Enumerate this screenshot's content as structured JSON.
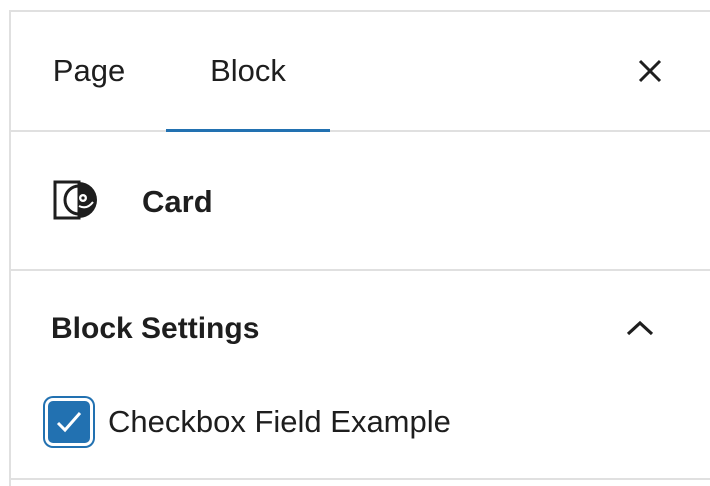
{
  "tabs": [
    {
      "label": "Page",
      "active": false
    },
    {
      "label": "Block",
      "active": true
    }
  ],
  "header": {
    "close_icon": "close-icon"
  },
  "block_card": {
    "icon": "card-block-icon",
    "title": "Card"
  },
  "settings_panel": {
    "title": "Block Settings",
    "expanded": true,
    "toggle_icon": "chevron-up-icon",
    "checkbox": {
      "label": "Checkbox Field Example",
      "checked": true
    }
  },
  "colors": {
    "accent": "#2271b1",
    "text": "#1e1e1e",
    "divider": "#e0e0e0"
  }
}
